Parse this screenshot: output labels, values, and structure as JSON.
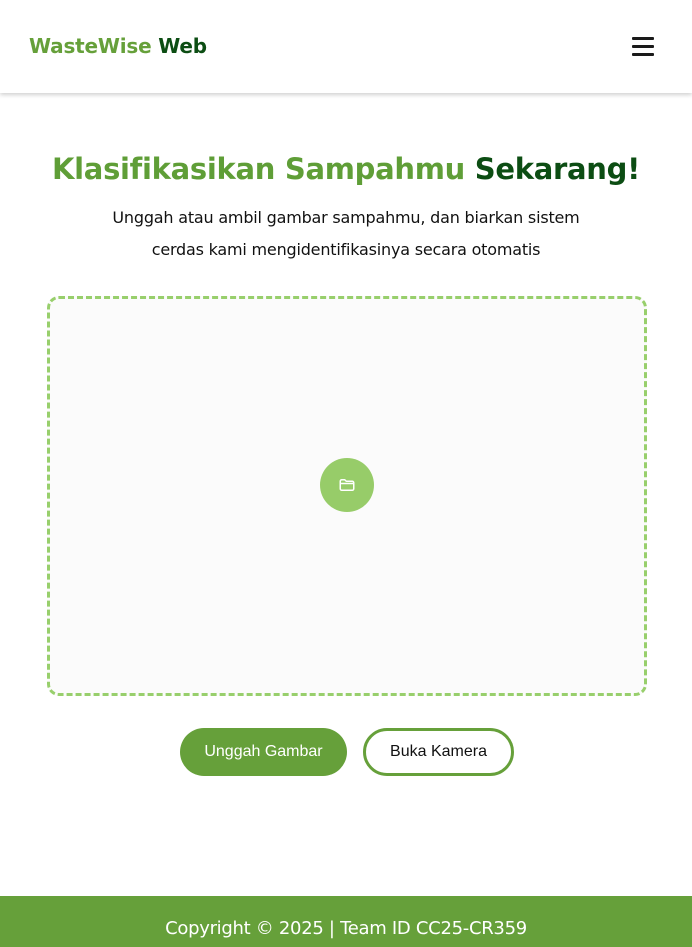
{
  "header": {
    "brand_part1": "WasteWise",
    "brand_part2": "Web",
    "menu_icon": "hamburger-menu-icon"
  },
  "hero": {
    "title_part1": "Klasifikasikan Sampahmu",
    "title_part2": "Sekarang!",
    "subtitle_line1": "Unggah atau ambil gambar sampahmu, dan biarkan sistem",
    "subtitle_line2": "cerdas kami mengidentifikasinya secara otomatis"
  },
  "dropzone": {
    "icon": "folder-icon"
  },
  "actions": {
    "upload_label": "Unggah Gambar",
    "camera_label": "Buka Kamera"
  },
  "footer": {
    "copyright": "Copyright © 2025 | Team ID CC25-CR359"
  },
  "colors": {
    "brand_green": "#66a03a",
    "dark_green": "#0c4d13",
    "light_green": "#97cc69",
    "dropzone_border": "#98cf6c"
  }
}
